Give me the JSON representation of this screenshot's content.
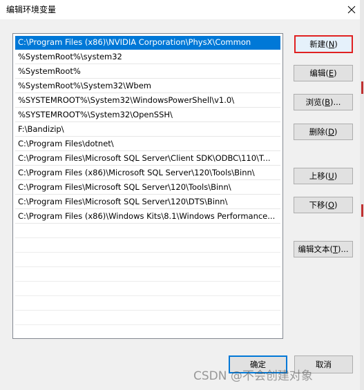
{
  "window": {
    "title": "编辑环境变量"
  },
  "path_list": {
    "items": [
      "C:\\Program Files (x86)\\NVIDIA Corporation\\PhysX\\Common",
      "%SystemRoot%\\system32",
      "%SystemRoot%",
      "%SystemRoot%\\System32\\Wbem",
      "%SYSTEMROOT%\\System32\\WindowsPowerShell\\v1.0\\",
      "%SYSTEMROOT%\\System32\\OpenSSH\\",
      "F:\\Bandizip\\",
      "C:\\Program Files\\dotnet\\",
      "C:\\Program Files\\Microsoft SQL Server\\Client SDK\\ODBC\\110\\T...",
      "C:\\Program Files (x86)\\Microsoft SQL Server\\120\\Tools\\Binn\\",
      "C:\\Program Files\\Microsoft SQL Server\\120\\Tools\\Binn\\",
      "C:\\Program Files\\Microsoft SQL Server\\120\\DTS\\Binn\\",
      "C:\\Program Files (x86)\\Windows Kits\\8.1\\Windows Performance..."
    ],
    "selected_index": 0
  },
  "buttons": {
    "new": {
      "label": "新建(",
      "key": "N",
      "close": ")"
    },
    "edit": {
      "label": "编辑(",
      "key": "E",
      "close": ")"
    },
    "browse": {
      "label": "浏览(",
      "key": "B",
      "close": ")..."
    },
    "delete": {
      "label": "删除(",
      "key": "D",
      "close": ")"
    },
    "move_up": {
      "label": "上移(",
      "key": "U",
      "close": ")"
    },
    "move_down": {
      "label": "下移(",
      "key": "O",
      "close": ")"
    },
    "edit_text": {
      "label": "编辑文本(",
      "key": "T",
      "close": ")..."
    },
    "ok": "确定",
    "cancel": "取消"
  },
  "watermark": "CSDN @不会创建对象",
  "colors": {
    "selection": "#0078d7",
    "highlight_border": "#e02020"
  }
}
